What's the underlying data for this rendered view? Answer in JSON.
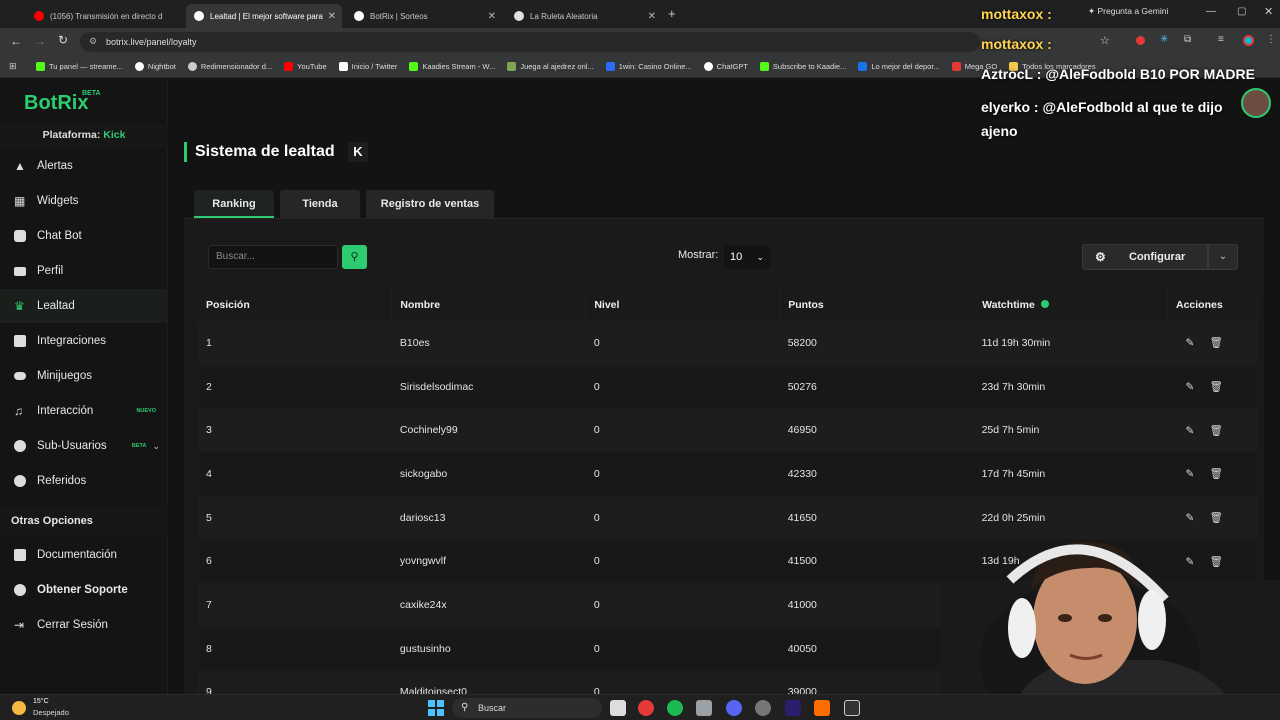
{
  "browser": {
    "tabs": [
      {
        "title": "(1056) Transmisión en directo d",
        "favicon_color": "#ff0000"
      },
      {
        "title": "Lealtad | El mejor software para",
        "favicon_color": "#ffffff"
      },
      {
        "title": "BotRix | Sorteos",
        "favicon_color": "#ffffff"
      },
      {
        "title": "La Ruleta Aleatoria",
        "favicon_color": "#e0e0e0"
      }
    ],
    "gemini_label": "Pregunta a Gemini",
    "url": "botrix.live/panel/loyalty",
    "bookmarks": [
      {
        "label": "Tu panel — streame...",
        "color": "#53fc18"
      },
      {
        "label": "Nightbot",
        "color": "#ffffff"
      },
      {
        "label": "Redimensionador d...",
        "color": "#cccccc"
      },
      {
        "label": "YouTube",
        "color": "#ff0000"
      },
      {
        "label": "Inicio / Twitter",
        "color": "#ffffff"
      },
      {
        "label": "Kaadies Stream - W...",
        "color": "#53fc18"
      },
      {
        "label": "Juega al ajedrez onl...",
        "color": "#7fa650"
      },
      {
        "label": "1win: Casino Online...",
        "color": "#2b6cff"
      },
      {
        "label": "ChatGPT",
        "color": "#ffffff"
      },
      {
        "label": "Subscribe to Kaadie...",
        "color": "#53fc18"
      },
      {
        "label": "Lo mejor del depor...",
        "color": "#1a73e8"
      },
      {
        "label": "Mega GO",
        "color": "#e53935"
      },
      {
        "label": "Todos los marcadores",
        "color": "#f2c94c"
      }
    ]
  },
  "sidebar": {
    "logo": "BotRix",
    "logo_badge": "BETA",
    "platform_label": "Plataforma:",
    "platform_value": "Kick",
    "items": [
      {
        "label": "Alertas",
        "icon": "warning-icon"
      },
      {
        "label": "Widgets",
        "icon": "grid-icon"
      },
      {
        "label": "Chat Bot",
        "icon": "robot-icon"
      },
      {
        "label": "Perfil",
        "icon": "id-card-icon"
      },
      {
        "label": "Lealtad",
        "icon": "trophy-icon"
      },
      {
        "label": "Integraciones",
        "icon": "list-icon"
      },
      {
        "label": "Minijuegos",
        "icon": "gamepad-icon"
      },
      {
        "label": "Interacción",
        "icon": "music-icon",
        "badge": "NUEVO"
      },
      {
        "label": "Sub-Usuarios",
        "icon": "users-icon",
        "badge": "BETA"
      },
      {
        "label": "Referidos",
        "icon": "user-group-icon"
      }
    ],
    "other_heading": "Otras Opciones",
    "other_items": [
      {
        "label": "Documentación",
        "icon": "doc-icon"
      },
      {
        "label": "Obtener Soporte",
        "icon": "help-icon"
      },
      {
        "label": "Cerrar Sesión",
        "icon": "logout-icon"
      }
    ]
  },
  "main": {
    "title": "Sistema de lealtad",
    "platform_icon": "K",
    "tabs": [
      "Ranking",
      "Tienda",
      "Registro de ventas"
    ],
    "search_placeholder": "Buscar...",
    "show_label": "Mostrar:",
    "show_value": "10",
    "configure_label": "Configurar",
    "columns": [
      "Posición",
      "Nombre",
      "Nivel",
      "Puntos",
      "Watchtime",
      "Acciones"
    ],
    "rows": [
      {
        "pos": "1",
        "name": "B10es",
        "level": "0",
        "points": "58200",
        "watchtime": "11d 19h 30min"
      },
      {
        "pos": "2",
        "name": "Sirisdelsodimac",
        "level": "0",
        "points": "50276",
        "watchtime": "23d 7h 30min"
      },
      {
        "pos": "3",
        "name": "Cochinely99",
        "level": "0",
        "points": "46950",
        "watchtime": "25d 7h 5min"
      },
      {
        "pos": "4",
        "name": "sickogabo",
        "level": "0",
        "points": "42330",
        "watchtime": "17d 7h 45min"
      },
      {
        "pos": "5",
        "name": "dariosc13",
        "level": "0",
        "points": "41650",
        "watchtime": "22d 0h 25min"
      },
      {
        "pos": "6",
        "name": "yovngwvlf",
        "level": "0",
        "points": "41500",
        "watchtime": "13d 19h"
      },
      {
        "pos": "7",
        "name": "caxike24x",
        "level": "0",
        "points": "41000",
        "watchtime": "9d 7"
      },
      {
        "pos": "8",
        "name": "gustusinho",
        "level": "0",
        "points": "40050",
        "watchtime": ""
      },
      {
        "pos": "9",
        "name": "Malditoinsect0",
        "level": "0",
        "points": "39000",
        "watchtime": ""
      }
    ]
  },
  "chat_overlay": [
    {
      "user": "mottaxox",
      "message": ""
    },
    {
      "user": "mottaxox",
      "message": ""
    },
    {
      "user": "AztrocL",
      "message": "@AleFodbold B10 POR MADRE"
    },
    {
      "user": "elyerko",
      "message": "@AleFodbold al que te dijo ajeno"
    }
  ],
  "taskbar": {
    "temperature": "15°C",
    "weather": "Despejado",
    "search_label": "Buscar"
  }
}
